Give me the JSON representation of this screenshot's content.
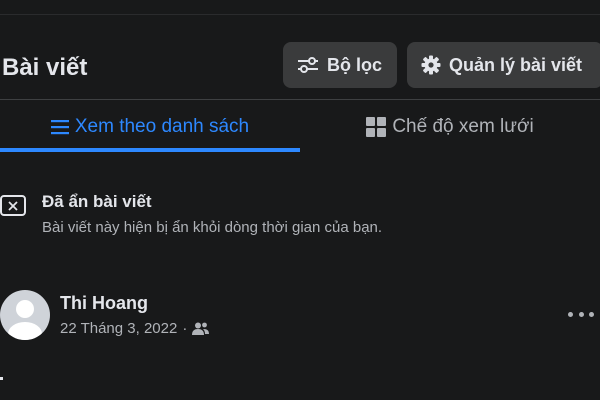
{
  "header": {
    "title": "Bài viết",
    "filter_label": "Bộ lọc",
    "manage_label": "Quản lý bài viết"
  },
  "tabs": [
    {
      "label": "Xem theo danh sách",
      "active": true,
      "icon": "list-icon"
    },
    {
      "label": "Chế độ xem lưới",
      "active": false,
      "icon": "grid-icon"
    }
  ],
  "hidden_notice": {
    "title": "Đã ẩn bài viết",
    "description": "Bài viết này hiện bị ẩn khỏi dòng thời gian của bạn.",
    "icon": "hidden-post-icon"
  },
  "post": {
    "author": "Thi Hoang",
    "date": "22 Tháng 3, 2022",
    "separator": "·",
    "audience_icon": "friends-icon",
    "more_icon": "more-options-icon"
  },
  "colors": {
    "background": "#18191a",
    "button": "#3a3b3c",
    "accent": "#2d88ff",
    "text_primary": "#e4e6eb",
    "text_secondary": "#b0b3b8"
  }
}
